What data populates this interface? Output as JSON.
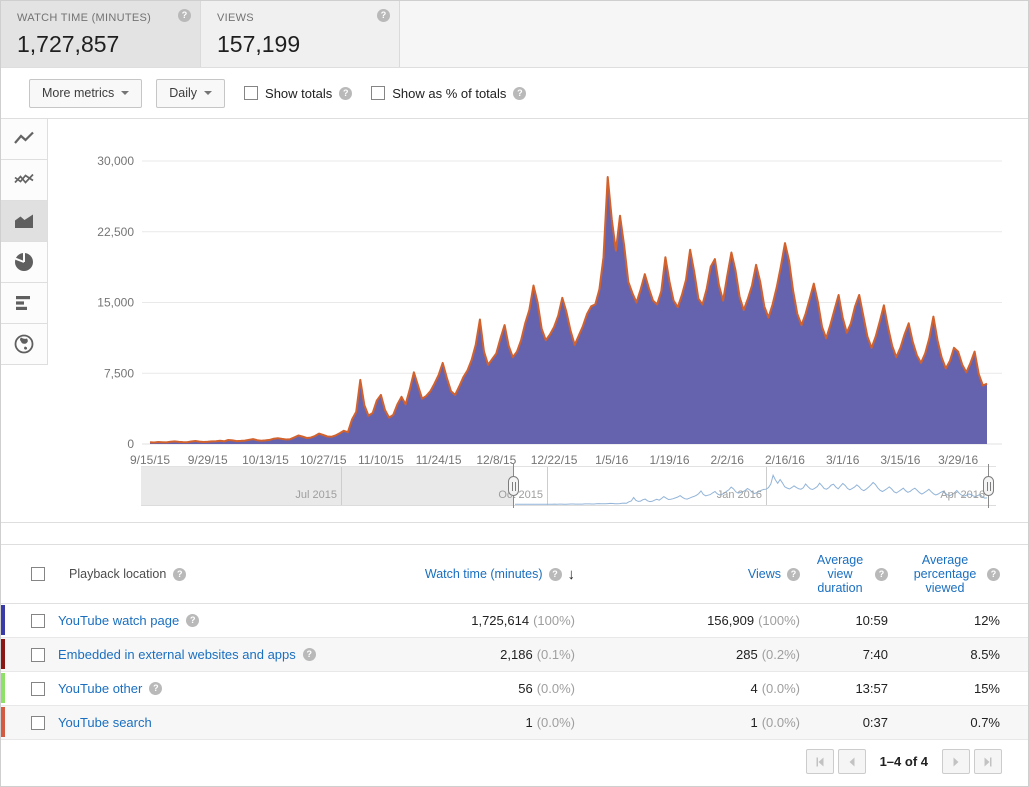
{
  "metrics_bar": {
    "cards": [
      {
        "label": "WATCH TIME (MINUTES)",
        "value": "1,727,857",
        "selected": true
      },
      {
        "label": "VIEWS",
        "value": "157,199",
        "selected": false
      }
    ]
  },
  "toolbar": {
    "more_metrics": "More metrics",
    "interval": "Daily",
    "show_totals": "Show totals",
    "show_percent": "Show as % of totals"
  },
  "sidebar": {
    "items": [
      {
        "name": "line-chart",
        "selected": false
      },
      {
        "name": "comparison-line-chart",
        "selected": false
      },
      {
        "name": "area-chart",
        "selected": true
      },
      {
        "name": "pie-chart",
        "selected": false
      },
      {
        "name": "bar-chart",
        "selected": false
      },
      {
        "name": "map-chart",
        "selected": false
      }
    ]
  },
  "icons": {
    "help": "?",
    "sort_desc": "↓"
  },
  "chart_data": {
    "type": "area",
    "title": "Watch time (minutes), daily",
    "series_name": "Watch time (minutes)",
    "date_start": "9/15/15",
    "date_end": "4/5/16",
    "x_tick_labels": [
      "9/15/15",
      "9/29/15",
      "10/13/15",
      "10/27/15",
      "11/10/15",
      "11/24/15",
      "12/8/15",
      "12/22/15",
      "1/5/16",
      "1/19/16",
      "2/2/16",
      "2/16/16",
      "3/1/16",
      "3/15/16",
      "3/29/16"
    ],
    "x_tick_days": [
      0,
      14,
      28,
      42,
      56,
      70,
      84,
      98,
      112,
      126,
      140,
      154,
      168,
      182,
      196
    ],
    "y_ticks": [
      0,
      7500,
      15000,
      22500,
      30000
    ],
    "y_tick_labels": [
      "0",
      "7,500",
      "15,000",
      "22,500",
      "30,000"
    ],
    "ylim": [
      0,
      30000
    ],
    "grid": true,
    "legend": "none",
    "area_color": "#6663ae",
    "line_color": "#d2622d",
    "spark_color": "#92b4d8",
    "values": [
      180,
      160,
      210,
      190,
      170,
      240,
      280,
      220,
      200,
      190,
      260,
      320,
      250,
      210,
      230,
      280,
      300,
      340,
      290,
      420,
      380,
      310,
      330,
      360,
      450,
      520,
      400,
      350,
      380,
      430,
      560,
      620,
      540,
      480,
      510,
      700,
      900,
      780,
      640,
      680,
      850,
      1100,
      950,
      800,
      760,
      900,
      1150,
      1400,
      1250,
      2600,
      3400,
      6800,
      4100,
      3000,
      3300,
      4600,
      5200,
      3600,
      2800,
      3100,
      4200,
      5000,
      4200,
      5800,
      7600,
      6200,
      4800,
      5100,
      5600,
      6400,
      7300,
      8600,
      7000,
      5600,
      5200,
      6100,
      7100,
      7800,
      8900,
      10500,
      13200,
      9800,
      8400,
      9000,
      9600,
      11200,
      12600,
      10400,
      9200,
      9800,
      11000,
      12800,
      14200,
      16800,
      15000,
      12200,
      11000,
      11600,
      12400,
      13600,
      15500,
      14000,
      12000,
      10500,
      11500,
      12500,
      13800,
      14600,
      14800,
      16400,
      19800,
      28300,
      23800,
      20500,
      24200,
      21000,
      17200,
      16000,
      15000,
      16400,
      18000,
      16500,
      15200,
      14800,
      16200,
      19800,
      17200,
      15200,
      14500,
      15800,
      17400,
      20600,
      18200,
      15400,
      14800,
      16400,
      18800,
      19600,
      16800,
      15200,
      17800,
      20300,
      18400,
      15600,
      14200,
      15400,
      16800,
      19000,
      17200,
      14600,
      13400,
      14800,
      16600,
      18800,
      21300,
      19400,
      16200,
      13800,
      12600,
      13800,
      15400,
      17000,
      15000,
      12400,
      11200,
      12600,
      14200,
      15800,
      13400,
      11800,
      12800,
      14600,
      15800,
      13600,
      11400,
      10200,
      11400,
      13000,
      14700,
      12400,
      10400,
      9200,
      10200,
      11600,
      12800,
      10800,
      9400,
      8600,
      9600,
      11200,
      13500,
      11000,
      9200,
      8000,
      8800,
      10200,
      9800,
      8400,
      7600,
      8600,
      9800,
      7400,
      6200,
      6400
    ]
  },
  "scrubber": {
    "labels": [
      "Jul 2015",
      "Oct 2015",
      "Jan 2016",
      "Apr 2016"
    ]
  },
  "table": {
    "header": {
      "location": "Playback location",
      "watch_time": "Watch time (minutes)",
      "views": "Views",
      "avg_view_duration": "Average view duration",
      "avg_percentage_viewed": "Average percentage viewed"
    },
    "rows": [
      {
        "label": "YouTube watch page",
        "color": "#3b3ba8",
        "watch_time": "1,725,614",
        "watch_pct": "(100%)",
        "views": "156,909",
        "views_pct": "(100%)",
        "avg_duration": "10:59",
        "avg_pct": "12%"
      },
      {
        "label": "Embedded in external websites and apps",
        "color": "#8a1713",
        "watch_time": "2,186",
        "watch_pct": "(0.1%)",
        "views": "285",
        "views_pct": "(0.2%)",
        "avg_duration": "7:40",
        "avg_pct": "8.5%"
      },
      {
        "label": "YouTube other",
        "color": "#8ee068",
        "watch_time": "56",
        "watch_pct": "(0.0%)",
        "views": "4",
        "views_pct": "(0.0%)",
        "avg_duration": "13:57",
        "avg_pct": "15%"
      },
      {
        "label": "YouTube search",
        "color": "#d45b43",
        "watch_time": "1",
        "watch_pct": "(0.0%)",
        "views": "1",
        "views_pct": "(0.0%)",
        "avg_duration": "0:37",
        "avg_pct": "0.7%"
      }
    ]
  },
  "pagination": {
    "label": "1–4 of  4"
  }
}
